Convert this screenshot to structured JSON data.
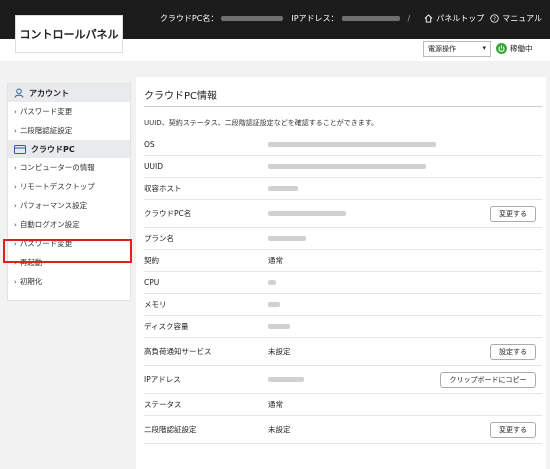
{
  "header": {
    "logo_label": "コントロールパネル",
    "pc_name_label": "クラウドPC名：",
    "ip_label": "IPアドレス：",
    "separator": "/",
    "panel_top_label": "パネルトップ",
    "manual_label": "マニュアル"
  },
  "subbar": {
    "power_select_value": "電源操作",
    "status_label": "稼働中",
    "status_color": "#3aa63a"
  },
  "sidebar": {
    "sections": [
      {
        "title": "アカウント",
        "icon": "user-icon",
        "items": [
          "パスワード変更",
          "二段階認証設定"
        ]
      },
      {
        "title": "クラウドPC",
        "icon": "monitor-icon",
        "items": [
          "コンピューターの情報",
          "リモートデスクトップ",
          "パフォーマンス設定",
          "自動ログオン設定",
          "パスワード変更",
          "再起動",
          "初期化"
        ]
      }
    ],
    "highlight_color": "#e0201e"
  },
  "main": {
    "title": "クラウドPC情報",
    "description": "UUID、契約ステータス、二段階認証設定などを確認することができます。",
    "rows": [
      {
        "key": "OS",
        "value": ""
      },
      {
        "key": "UUID",
        "value": ""
      },
      {
        "key": "収容ホスト",
        "value": ""
      },
      {
        "key": "クラウドPC名",
        "value": "",
        "button": "変更する"
      },
      {
        "key": "プラン名",
        "value": ""
      },
      {
        "key": "契約",
        "value": "通常"
      },
      {
        "key": "CPU",
        "value": ""
      },
      {
        "key": "メモリ",
        "value": ""
      },
      {
        "key": "ディスク容量",
        "value": ""
      },
      {
        "key": "高負荷通知サービス",
        "value": "未設定",
        "button": "設定する"
      },
      {
        "key": "IPアドレス",
        "value": "",
        "button": "クリップボードにコピー"
      },
      {
        "key": "ステータス",
        "value": "通常"
      },
      {
        "key": "二段階認証設定",
        "value": "未設定",
        "button": "変更する"
      }
    ]
  }
}
